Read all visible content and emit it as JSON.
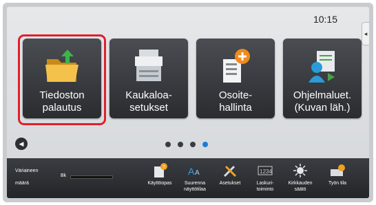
{
  "status": {
    "clock": "10:15"
  },
  "tiles": [
    {
      "label_line1": "Tiedoston",
      "label_line2": "palautus"
    },
    {
      "label_line1": "Kaukaloa-",
      "label_line2": "setukset"
    },
    {
      "label_line1": "Osoite-",
      "label_line2": "hallinta"
    },
    {
      "label_line1": "Ohjelmaluet.",
      "label_line2": "(Kuvan läh.)"
    }
  ],
  "pagination": {
    "active_page": 4,
    "total_pages": 4
  },
  "toner": {
    "label_line1": "Väriaineen",
    "label_line2": "määrä",
    "color_label": "Bk"
  },
  "bottom_bar": [
    {
      "line1": "Käyttöopas",
      "line2": ""
    },
    {
      "line1": "Suurenna",
      "line2": "näyttötilaa"
    },
    {
      "line1": "Asetukset",
      "line2": ""
    },
    {
      "line1": "Laskuri-",
      "line2": "toiminto"
    },
    {
      "line1": "Kirkkauden",
      "line2": "säätö"
    },
    {
      "line1": "Työn tila",
      "line2": ""
    }
  ],
  "colors": {
    "highlight": "#e01f2c",
    "active_dot": "#1e7bd8",
    "tile": "#3a3d42"
  }
}
